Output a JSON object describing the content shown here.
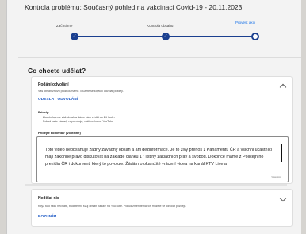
{
  "window": {
    "title": "Kontrola problému: Současný pohled na vakcinaci Covid-19 - 20.11.2023"
  },
  "stepper": {
    "steps": [
      {
        "label": "Začínáme",
        "state": "done"
      },
      {
        "label": "Kontrola obsahu",
        "state": "done"
      },
      {
        "label": "Provést akci",
        "state": "current"
      }
    ],
    "accent": "#1a3f8f"
  },
  "question": "Co chcete udělat?",
  "appeal": {
    "title": "Podání odvolání",
    "subtitle": "Váš obsah znovu prozkoumáme. Můžete se kdykoli odvolat později.",
    "action_label": "ODESLAT ODVOLÁNÍ",
    "principle_title": "Princip",
    "principles": [
      "Zkontrolujeme váš obsah a dáme vám vědět do 24 hodin",
      "Pokud naše zásady neporušuje, vrátíme ho na YouTube"
    ],
    "comment_label": "Přidejte komentář (volitelné)",
    "comment_value": "Toto video neobsahuje žádný závadný obsah a ani dezinformace. Je to živý přenos z Parlamentu ČR a všichni účastníci mají zákonné právo diskutovat na základě článku 17 listiny základních práv a svobod. Dokonce máme z Policejního prezidia ČR i dokument, který to povoluje. Žádám o okamžité vrácení videa na kanál KTV Live a",
    "char_counter": "239/800"
  },
  "nothing": {
    "title": "Nedělat nic",
    "subtitle": "Když tuto radu necháte, budete mít svůj obsah nadále na YouTube. Pokud změníte názor, můžete se odvolat později.",
    "action_label": "ROZUMÍM"
  }
}
